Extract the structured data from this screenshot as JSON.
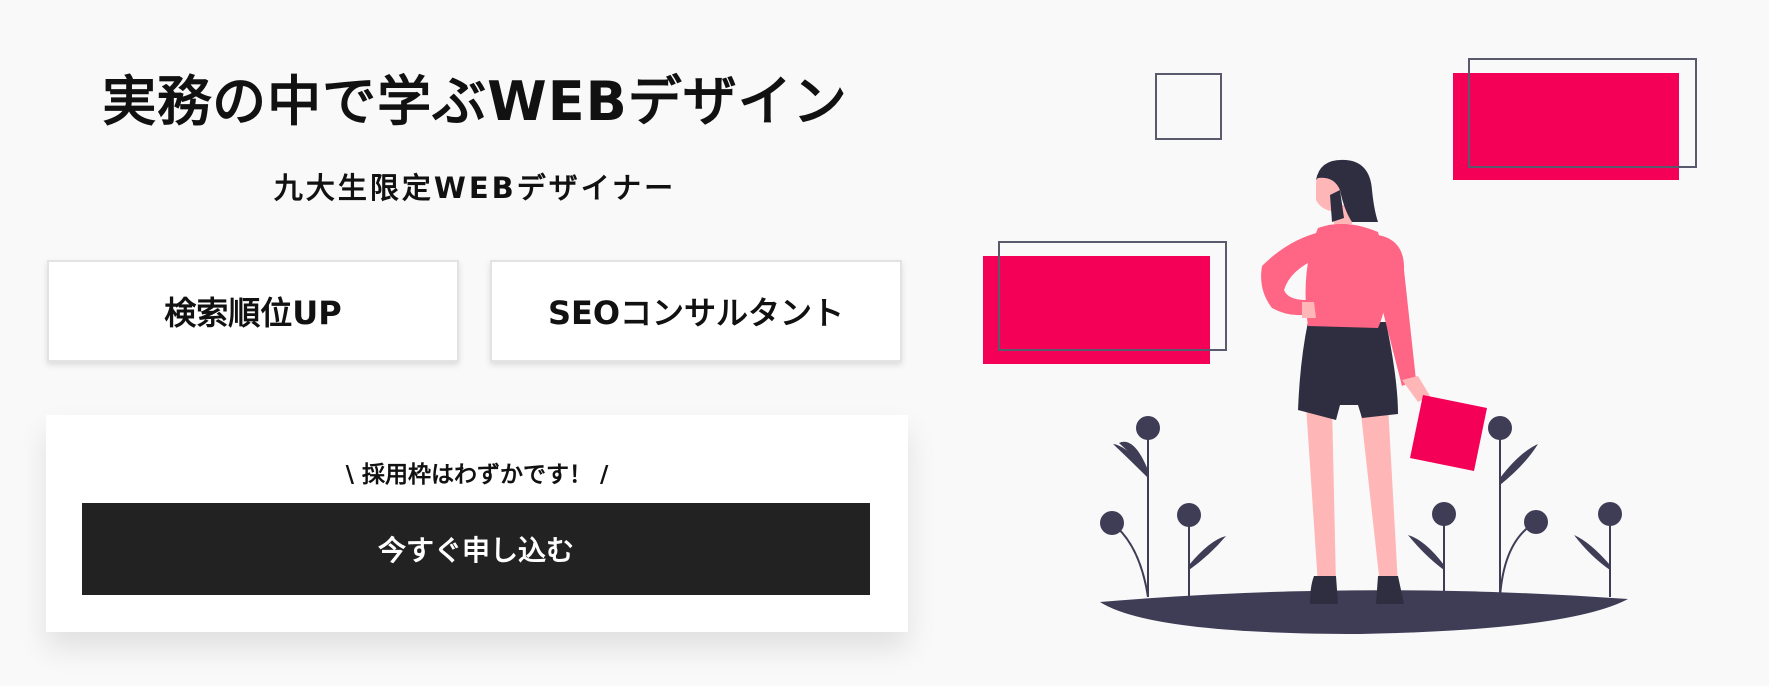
{
  "hero": {
    "title": "実務の中で学ぶWEBデザイン",
    "subtitle": "九大生限定WEBデザイナー"
  },
  "features": [
    {
      "label": "検索順位UP"
    },
    {
      "label": "SEOコンサルタント"
    }
  ],
  "cta": {
    "note": "\\ 採用枠はわずかです！ /",
    "button_label": "今すぐ申し込む"
  },
  "colors": {
    "accent": "#f50057",
    "button": "#222222",
    "background": "#f9f9fa",
    "figure_skin": "#ffb6b6",
    "figure_top": "#ff6584",
    "dark": "#2f2e41"
  },
  "illustration": {
    "icon": "woman-with-folder-illustration"
  }
}
